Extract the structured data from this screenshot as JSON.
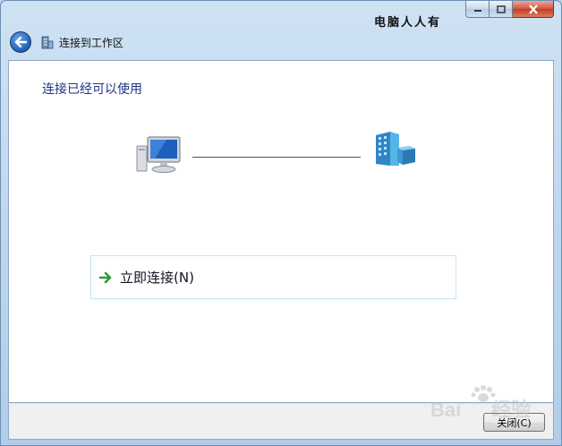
{
  "window": {
    "title": "连接到工作区",
    "watermark_top": "电脑人人有",
    "caption_buttons": {
      "minimize_icon": "minimize-icon",
      "maximize_icon": "maximize-icon",
      "close_icon": "close-icon"
    }
  },
  "content": {
    "heading": "连接已经可以使用",
    "computer_icon": "computer-icon",
    "network_icon": "workplace-network-icon",
    "connect_option": {
      "label": "立即连接(N)",
      "icon": "green-arrow-icon"
    }
  },
  "footer": {
    "close_button": "关闭(C)"
  },
  "watermark_br": {
    "text": "Bai",
    "text2": "经验"
  },
  "colors": {
    "heading": "#1e3287",
    "accent_arrow": "#2e9a3a",
    "close_hover": "#c43c23"
  }
}
